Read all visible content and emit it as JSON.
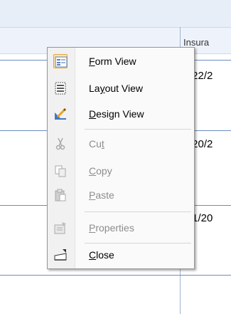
{
  "grid": {
    "header_partial": "Insura",
    "rows": [
      {
        "value_partial": "/22/2"
      },
      {
        "value_partial": "/20/2"
      },
      {
        "value_partial": "/1/20"
      }
    ]
  },
  "menu": {
    "items": [
      {
        "pre": "",
        "key": "F",
        "post": "orm View",
        "icon": "form-view-icon",
        "enabled": true
      },
      {
        "pre": "La",
        "key": "y",
        "post": "out View",
        "icon": "layout-view-icon",
        "enabled": true
      },
      {
        "pre": "",
        "key": "D",
        "post": "esign View",
        "icon": "design-view-icon",
        "enabled": true
      },
      {
        "pre": "Cu",
        "key": "t",
        "post": "",
        "icon": "scissors-icon",
        "enabled": false
      },
      {
        "pre": "",
        "key": "C",
        "post": "opy",
        "icon": "copy-icon",
        "enabled": false
      },
      {
        "pre": "",
        "key": "P",
        "post": "aste",
        "icon": "paste-icon",
        "enabled": false
      },
      {
        "pre": "",
        "key": "P",
        "post": "roperties",
        "icon": "properties-icon",
        "enabled": false
      },
      {
        "pre": "",
        "key": "C",
        "post": "lose",
        "icon": "close-window-icon",
        "enabled": true
      }
    ]
  },
  "colors": {
    "accent_highlight": "#e3a23b",
    "disabled_text": "#8d8d8d",
    "grid_line": "#6b8cc0"
  }
}
